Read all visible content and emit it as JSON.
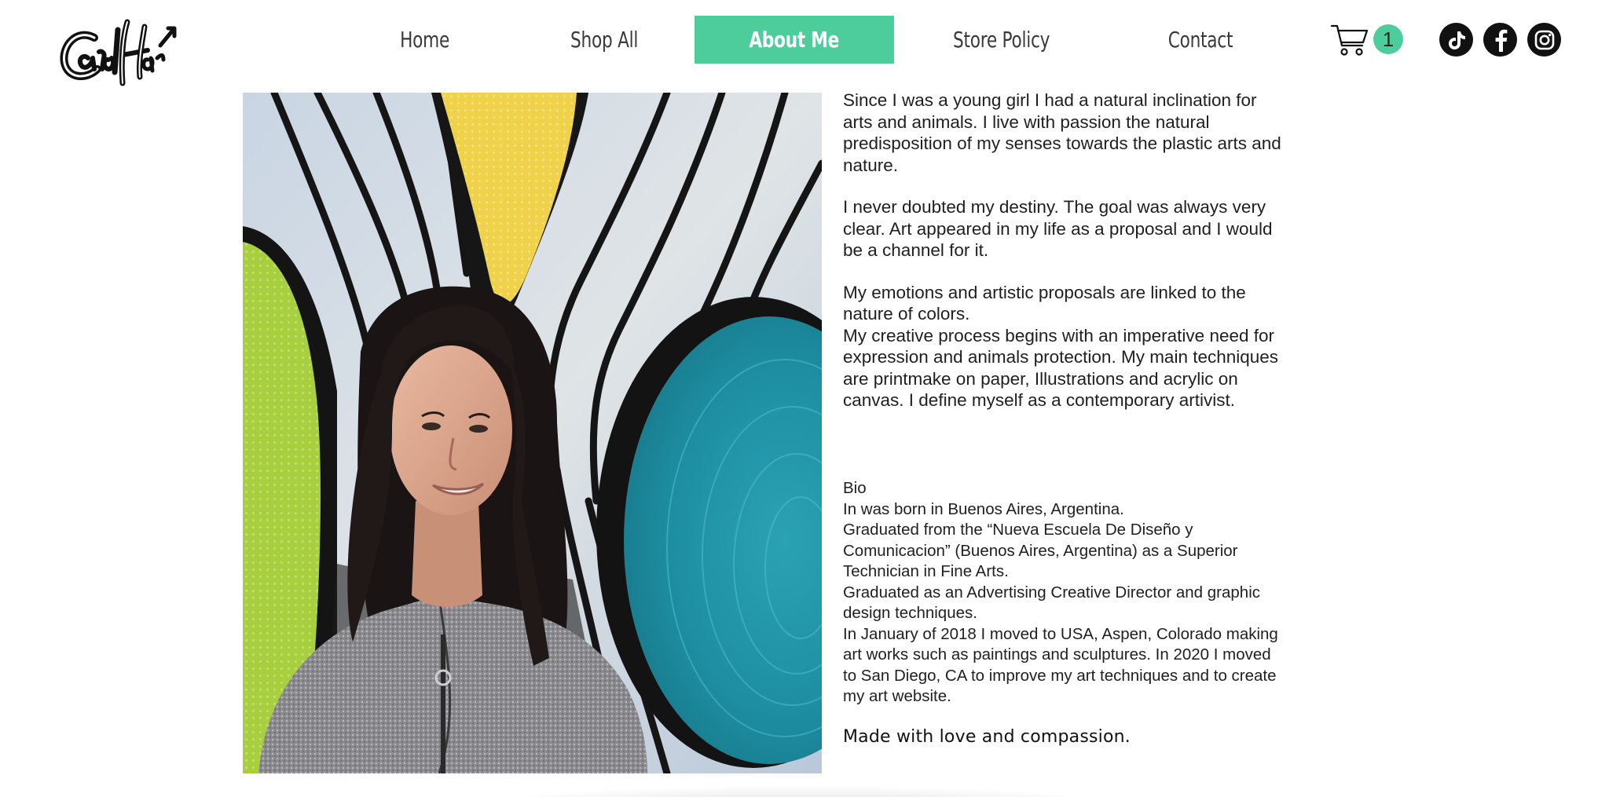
{
  "header": {
    "logo_text": "CarolHar",
    "nav": [
      {
        "label": "Home",
        "active": false
      },
      {
        "label": "Shop All",
        "active": false
      },
      {
        "label": "About Me",
        "active": true
      },
      {
        "label": "Store Policy",
        "active": false
      },
      {
        "label": "Contact",
        "active": false
      }
    ],
    "cart": {
      "icon": "cart-icon",
      "count": "1"
    },
    "social": [
      {
        "name": "tiktok",
        "icon": "tiktok-icon"
      },
      {
        "name": "facebook",
        "icon": "facebook-icon"
      },
      {
        "name": "instagram",
        "icon": "instagram-icon"
      }
    ]
  },
  "colors": {
    "accent": "#4ecd9c",
    "text": "#1f1f1f",
    "social": "#111111"
  },
  "about": {
    "paragraphs": [
      "Since I was a young girl I had a natural inclination for arts and animals. I live with passion the natural predisposition of my senses towards the plastic arts and nature.",
      "I never doubted my destiny. The goal was always very clear. Art appeared in my life as a proposal and I would be a channel for it.",
      "My emotions and artistic proposals are linked to the nature of colors.",
      "My creative process begins with an imperative need for expression and animals protection. My main techniques are printmake on paper, Illustrations and acrylic on canvas. I define myself as a contemporary artivist."
    ],
    "bio_lines": [
      "Bio",
      "In was born in Buenos Aires, Argentina.",
      "Graduated from the “Nueva Escuela De Diseño y Comunicacion” (Buenos Aires, Argentina) as a Superior Technician in Fine Arts.",
      "Graduated as an Advertising Creative Director and graphic design techniques.",
      "In January of 2018 I moved to USA, Aspen, Colorado making art works such as paintings and sculptures. In 2020 I moved to San Diego, CA to improve my art techniques and to create my art website."
    ],
    "signoff": "Made with love and compassion."
  }
}
